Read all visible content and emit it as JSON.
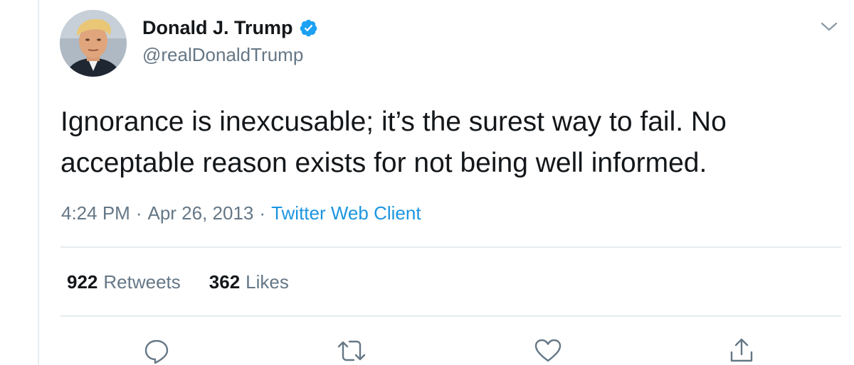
{
  "author": {
    "display_name": "Donald J. Trump",
    "handle": "@realDonaldTrump",
    "verified": true,
    "avatar_icon": "profile-photo"
  },
  "tweet": {
    "text_lines": [
      "Ignorance is inexcusable; it’s the surest way to fail. No",
      "acceptable reason exists for not being well informed."
    ],
    "time": "4:24 PM",
    "date": "Apr 26, 2013",
    "separator": "·",
    "source": "Twitter Web Client"
  },
  "stats": {
    "retweets_count": "922",
    "retweets_label": "Retweets",
    "likes_count": "362",
    "likes_label": "Likes"
  },
  "actions": [
    {
      "name": "reply",
      "icon": "speech-bubble-icon"
    },
    {
      "name": "retweet",
      "icon": "retweet-arrows-icon"
    },
    {
      "name": "like",
      "icon": "heart-icon"
    },
    {
      "name": "share",
      "icon": "share-upload-icon"
    }
  ],
  "colors": {
    "text": "#14171a",
    "secondary": "#657786",
    "link": "#1b95e0",
    "verified": "#1da1f2",
    "divider": "#e6ecf0"
  }
}
